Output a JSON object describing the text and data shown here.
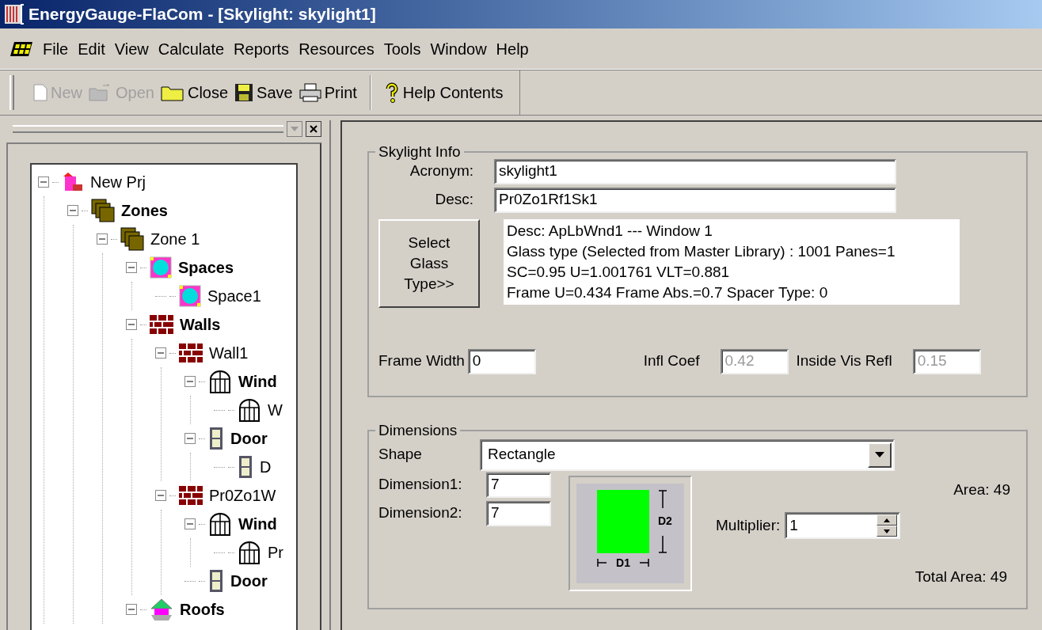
{
  "window": {
    "title": "EnergyGauge-FlaCom - [Skylight: skylight1]"
  },
  "menu": [
    "File",
    "Edit",
    "View",
    "Calculate",
    "Reports",
    "Resources",
    "Tools",
    "Window",
    "Help"
  ],
  "toolbar": [
    {
      "kind": "new",
      "label": "New",
      "disabled": true
    },
    {
      "kind": "open",
      "label": "Open",
      "disabled": true
    },
    {
      "kind": "close",
      "label": "Close",
      "disabled": false
    },
    {
      "kind": "save",
      "label": "Save",
      "disabled": false
    },
    {
      "kind": "print",
      "label": "Print",
      "disabled": false
    },
    {
      "kind": "help",
      "label": "Help Contents",
      "disabled": false
    }
  ],
  "tree": [
    {
      "label": "New Prj",
      "kind": "project",
      "bold": false,
      "expanded": true,
      "children": [
        {
          "label": "Zones",
          "kind": "zones",
          "bold": true,
          "expanded": true,
          "children": [
            {
              "label": "Zone 1",
              "kind": "zones",
              "bold": false,
              "expanded": true,
              "children": [
                {
                  "label": "Spaces",
                  "kind": "space",
                  "bold": true,
                  "expanded": true,
                  "children": [
                    {
                      "label": "Space1",
                      "kind": "space",
                      "bold": false
                    }
                  ]
                },
                {
                  "label": "Walls",
                  "kind": "wall",
                  "bold": true,
                  "expanded": true,
                  "children": [
                    {
                      "label": "Wall1",
                      "kind": "wall",
                      "bold": false,
                      "expanded": true,
                      "children": [
                        {
                          "label": "Wind",
                          "kind": "window",
                          "bold": true,
                          "expanded": true,
                          "children": [
                            {
                              "label": "W",
                              "kind": "window",
                              "bold": false
                            }
                          ]
                        },
                        {
                          "label": "Door",
                          "kind": "door",
                          "bold": true,
                          "expanded": true,
                          "children": [
                            {
                              "label": "D",
                              "kind": "door",
                              "bold": false
                            }
                          ]
                        }
                      ]
                    },
                    {
                      "label": "Pr0Zo1W",
                      "kind": "wall",
                      "bold": false,
                      "expanded": true,
                      "children": [
                        {
                          "label": "Wind",
                          "kind": "window",
                          "bold": true,
                          "expanded": true,
                          "children": [
                            {
                              "label": "Pr",
                              "kind": "window",
                              "bold": false
                            }
                          ]
                        },
                        {
                          "label": "Door",
                          "kind": "door",
                          "bold": true
                        }
                      ]
                    }
                  ]
                },
                {
                  "label": "Roofs",
                  "kind": "roof",
                  "bold": true,
                  "expanded": true
                }
              ]
            }
          ]
        }
      ]
    }
  ],
  "skylight_info": {
    "title": "Skylight Info",
    "acronym": {
      "label": "Acronym:",
      "value": "skylight1"
    },
    "desc": {
      "label": "Desc:",
      "value": "Pr0Zo1Rf1Sk1"
    },
    "select_button": [
      "Select",
      "Glass",
      "Type>>"
    ],
    "glass_info": [
      "Desc: ApLbWnd1 --- Window 1",
      "Glass type (Selected from Master Library) : 1001 Panes=1",
      "SC=0.95 U=1.001761 VLT=0.881",
      "Frame U=0.434 Frame Abs.=0.7 Spacer Type: 0"
    ],
    "fields": [
      {
        "label": "Frame Width",
        "value": "0",
        "disabled": false
      },
      {
        "label": "Infl Coef",
        "value": "0.42",
        "disabled": true
      },
      {
        "label": "Inside Vis Refl",
        "value": "0.15",
        "disabled": true
      }
    ]
  },
  "dimensions": {
    "title": "Dimensions",
    "shape": {
      "label": "Shape",
      "value": "Rectangle"
    },
    "dimension1": {
      "label": "Dimension1:",
      "value": "7"
    },
    "dimension2": {
      "label": "Dimension2:",
      "value": "7"
    },
    "diagram": {
      "d1": "D1",
      "d2": "D2"
    },
    "multiplier": {
      "label": "Multiplier:",
      "value": "1"
    },
    "area": "Area: 49",
    "total_area": "Total Area: 49"
  }
}
